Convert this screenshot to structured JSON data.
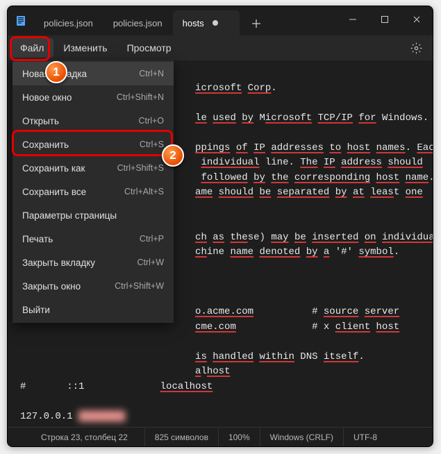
{
  "tabs": [
    {
      "label": "policies.json",
      "active": false,
      "modified": false
    },
    {
      "label": "policies.json",
      "active": false,
      "modified": false
    },
    {
      "label": "hosts",
      "active": true,
      "modified": true
    }
  ],
  "menubar": {
    "file": "Файл",
    "edit": "Изменить",
    "view": "Просмотр"
  },
  "file_menu": [
    {
      "label": "Новая вкладка",
      "shortcut": "Ctrl+N",
      "hover": true
    },
    {
      "label": "Новое окно",
      "shortcut": "Ctrl+Shift+N",
      "hover": false
    },
    {
      "label": "Открыть",
      "shortcut": "Ctrl+O",
      "hover": false
    },
    {
      "label": "Сохранить",
      "shortcut": "Ctrl+S",
      "hover": false
    },
    {
      "label": "Сохранить как",
      "shortcut": "Ctrl+Shift+S",
      "hover": false
    },
    {
      "label": "Сохранить все",
      "shortcut": "Ctrl+Alt+S",
      "hover": false
    },
    {
      "label": "Параметры страницы",
      "shortcut": "",
      "hover": false
    },
    {
      "label": "Печать",
      "shortcut": "Ctrl+P",
      "hover": false
    },
    {
      "label": "Закрыть вкладку",
      "shortcut": "Ctrl+W",
      "hover": false
    },
    {
      "label": "Закрыть окно",
      "shortcut": "Ctrl+Shift+W",
      "hover": false
    },
    {
      "label": "Выйти",
      "shortcut": "",
      "hover": false
    }
  ],
  "editor_lines": [
    "",
    "                              icrosoft Corp.",
    "",
    "                              le used by Microsoft TCP/IP for Windows.",
    "",
    "                              ppings of IP addresses to host names. Each",
    "                               individual line. The IP address should",
    "                               followed by the corresponding host name.",
    "                              ame should be separated by at least one",
    "",
    "",
    "                              ch as these) may be inserted on individual",
    "                              chine name denoted by a '#' symbol.",
    "",
    "",
    "",
    "                              o.acme.com          # source server",
    "                              cme.com             # x client host",
    "",
    "                              is handled within DNS itself.",
    "                              alhost",
    "#       ::1             localhost",
    "",
    "127.0.0.1 "
  ],
  "statusbar": {
    "pos": "Строка 23, столбец 22",
    "chars": "825 символов",
    "zoom": "100%",
    "eol": "Windows (CRLF)",
    "enc": "UTF-8"
  },
  "badges": {
    "b1": "1",
    "b2": "2"
  }
}
